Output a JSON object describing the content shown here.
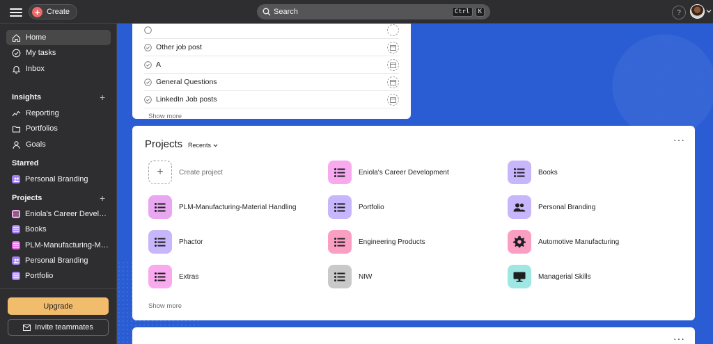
{
  "topbar": {
    "create_label": "Create",
    "search_label": "Search",
    "shortcut_keys": [
      "Ctrl",
      "K"
    ],
    "help_label": "?"
  },
  "sidebar": {
    "nav": [
      {
        "label": "Home",
        "icon": "home-icon",
        "active": true
      },
      {
        "label": "My tasks",
        "icon": "check-circle-icon"
      },
      {
        "label": "Inbox",
        "icon": "bell-icon"
      }
    ],
    "insights_heading": "Insights",
    "insights": [
      {
        "label": "Reporting",
        "icon": "chart-line-icon"
      },
      {
        "label": "Portfolios",
        "icon": "folder-icon"
      },
      {
        "label": "Goals",
        "icon": "person-icon"
      }
    ],
    "starred_heading": "Starred",
    "starred": [
      {
        "label": "Personal Branding",
        "color": "#a17ff1"
      }
    ],
    "projects_heading": "Projects",
    "projects": [
      {
        "label": "Eniola's Career Developm...",
        "color": "#f9aaef"
      },
      {
        "label": "Books",
        "color": "#a17ff1"
      },
      {
        "label": "PLM-Manufacturing-Mate...",
        "color": "#e362e3"
      },
      {
        "label": "Personal Branding",
        "color": "#a17ff1"
      },
      {
        "label": "Portfolio",
        "color": "#a17ff1"
      }
    ],
    "upgrade_label": "Upgrade",
    "invite_label": "Invite teammates"
  },
  "tasks_card": {
    "rows": [
      {
        "label": "Other job post"
      },
      {
        "label": "A"
      },
      {
        "label": "General Questions"
      },
      {
        "label": "LinkedIn Job posts"
      }
    ],
    "show_more": "Show more"
  },
  "projects_card": {
    "title": "Projects",
    "filter_label": "Recents",
    "more_label": "···",
    "create_label": "Create project",
    "tiles": [
      {
        "label": "Eniola's Career Development",
        "color": "#f9aaef",
        "icon": "list-icon"
      },
      {
        "label": "Books",
        "color": "#c7b6fb",
        "icon": "list-icon"
      },
      {
        "label": "PLM-Manufacturing-Material Handling",
        "color": "#e8a7f0",
        "icon": "list-icon"
      },
      {
        "label": "Portfolio",
        "color": "#c7b6fb",
        "icon": "list-icon"
      },
      {
        "label": "Personal Branding",
        "color": "#c7b6fb",
        "icon": "people-icon"
      },
      {
        "label": "Phactor",
        "color": "#c7b6fb",
        "icon": "list-icon"
      },
      {
        "label": "Engineering Products",
        "color": "#fa9fc2",
        "icon": "list-icon"
      },
      {
        "label": "Automotive Manufacturing",
        "color": "#fa9fc2",
        "icon": "gear-icon"
      },
      {
        "label": "Extras",
        "color": "#f9aaef",
        "icon": "list-icon"
      },
      {
        "label": "NIW",
        "color": "#c9c9c9",
        "icon": "list-icon"
      },
      {
        "label": "Managerial Skills",
        "color": "#9ee7e3",
        "icon": "monitor-icon"
      }
    ],
    "show_more": "Show more"
  },
  "bottom_card": {
    "more_label": "···"
  }
}
